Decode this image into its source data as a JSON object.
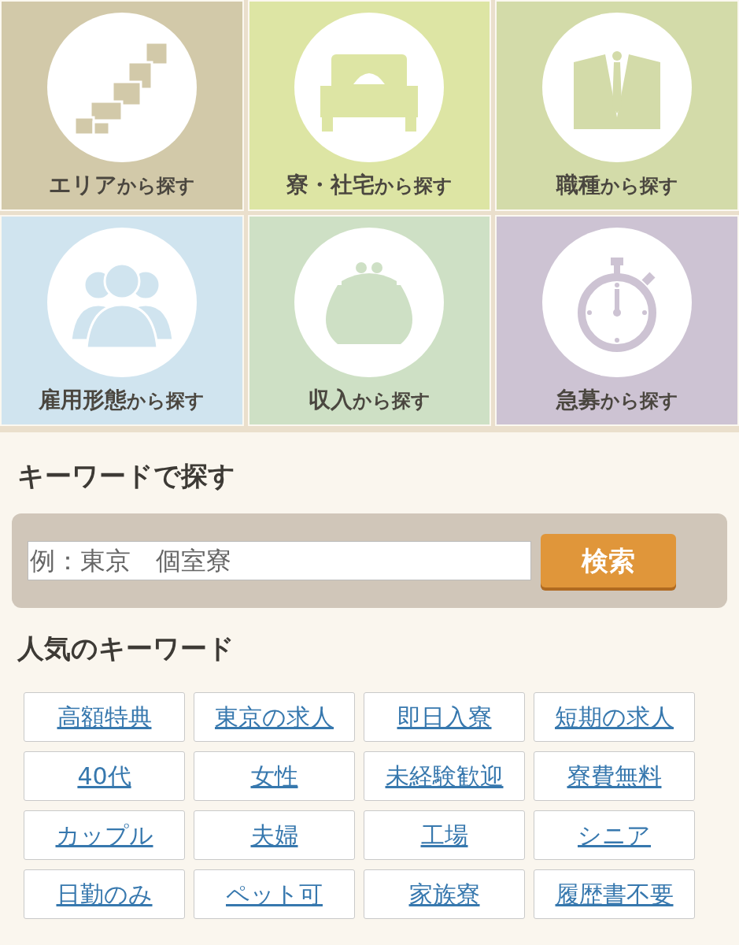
{
  "categories": [
    {
      "name": "エリア",
      "suffix": "から探す",
      "color": "#d2c9a9"
    },
    {
      "name": "寮・社宅",
      "suffix": "から探す",
      "color": "#dde5a4"
    },
    {
      "name": "職種",
      "suffix": "から探す",
      "color": "#d3dba9"
    },
    {
      "name": "雇用形態",
      "suffix": "から探す",
      "color": "#d0e4ef"
    },
    {
      "name": "収入",
      "suffix": "から探す",
      "color": "#cee0c5"
    },
    {
      "name": "急募",
      "suffix": "から探す",
      "color": "#cdc3d3"
    }
  ],
  "keyword_search": {
    "heading": "キーワードで探す",
    "placeholder": "例：東京　個室寮",
    "button": "検索"
  },
  "popular": {
    "heading": "人気のキーワード",
    "tags": [
      "高額特典",
      "東京の求人",
      "即日入寮",
      "短期の求人",
      "40代",
      "女性",
      "未経験歓迎",
      "寮費無料",
      "カップル",
      "夫婦",
      "工場",
      "シニア",
      "日勤のみ",
      "ペット可",
      "家族寮",
      "履歴書不要"
    ]
  }
}
